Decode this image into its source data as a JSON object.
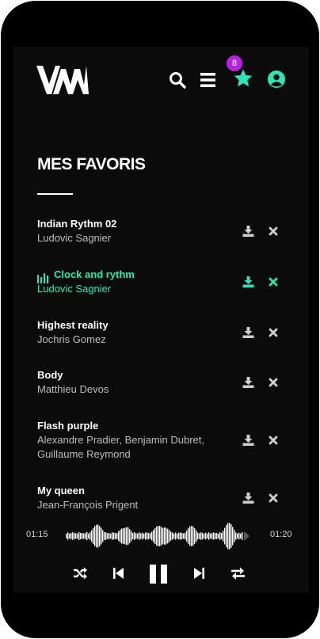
{
  "header": {
    "logo_text": "VAM",
    "favorites_count": "8",
    "icons": [
      "search-icon",
      "menu-icon",
      "star-icon",
      "user-icon"
    ],
    "colors": {
      "accent": "#2ee6b4",
      "badge": "#b622e0"
    }
  },
  "page": {
    "title": "MES FAVORIS"
  },
  "tracks": [
    {
      "title": "Indian Rythm 02",
      "artist": "Ludovic Sagnier",
      "playing": false
    },
    {
      "title": "Clock and rythm",
      "artist": "Ludovic Sagnier",
      "playing": true
    },
    {
      "title": "Highest reality",
      "artist": "Jochris Gomez",
      "playing": false
    },
    {
      "title": "Body",
      "artist": "Matthieu Devos",
      "playing": false
    },
    {
      "title": "Flash purple",
      "artist": "Alexandre Pradier, Benjamin Dubret, Guillaume Reymond",
      "playing": false
    },
    {
      "title": "My queen",
      "artist": "Jean-François Prigent",
      "playing": false
    }
  ],
  "player": {
    "elapsed": "01:15",
    "duration": "01:20",
    "icons": [
      "shuffle-icon",
      "previous-icon",
      "pause-icon",
      "next-icon",
      "repeat-icon"
    ]
  }
}
